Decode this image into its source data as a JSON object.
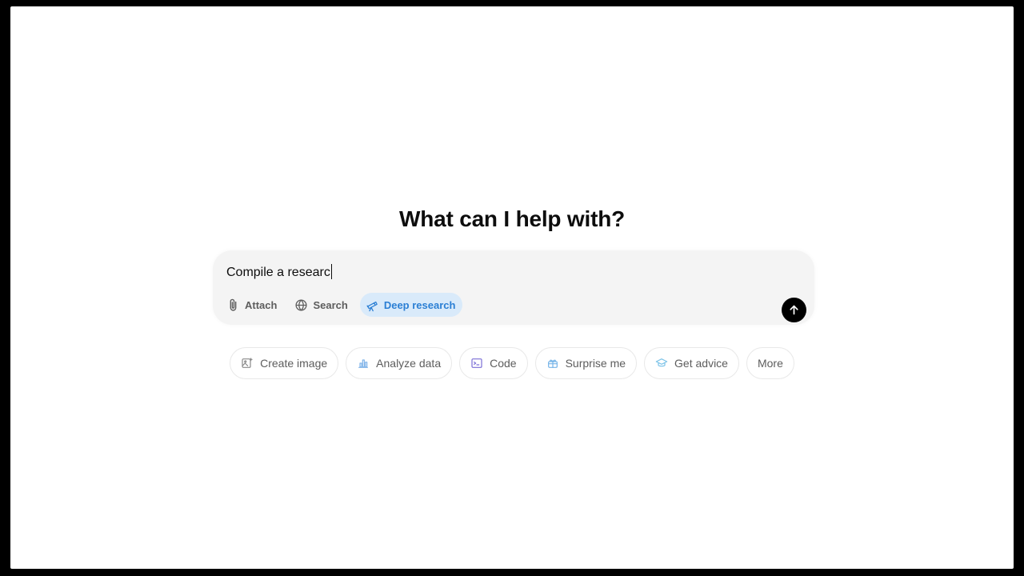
{
  "heading": "What can I help with?",
  "composer": {
    "input_value": "Compile a researc",
    "tools": [
      {
        "label": "Attach",
        "icon": "paperclip-icon",
        "active": false
      },
      {
        "label": "Search",
        "icon": "globe-icon",
        "active": false
      },
      {
        "label": "Deep research",
        "icon": "telescope-icon",
        "active": true
      }
    ],
    "send_icon": "arrow-up-icon"
  },
  "suggestions": [
    {
      "label": "Create image",
      "icon": "image-icon",
      "color": "#8a8a8a"
    },
    {
      "label": "Analyze data",
      "icon": "bar-chart-icon",
      "color": "#7fb3e8"
    },
    {
      "label": "Code",
      "icon": "terminal-icon",
      "color": "#7b6fd6"
    },
    {
      "label": "Surprise me",
      "icon": "gift-icon",
      "color": "#76b4e8"
    },
    {
      "label": "Get advice",
      "icon": "graduation-cap-icon",
      "color": "#7cc3e8"
    },
    {
      "label": "More",
      "icon": "",
      "color": ""
    }
  ],
  "colors": {
    "accent": "#2b7fd4",
    "accent_bg": "#d9eafa",
    "composer_bg": "#f4f4f4",
    "send_bg": "#000000"
  }
}
